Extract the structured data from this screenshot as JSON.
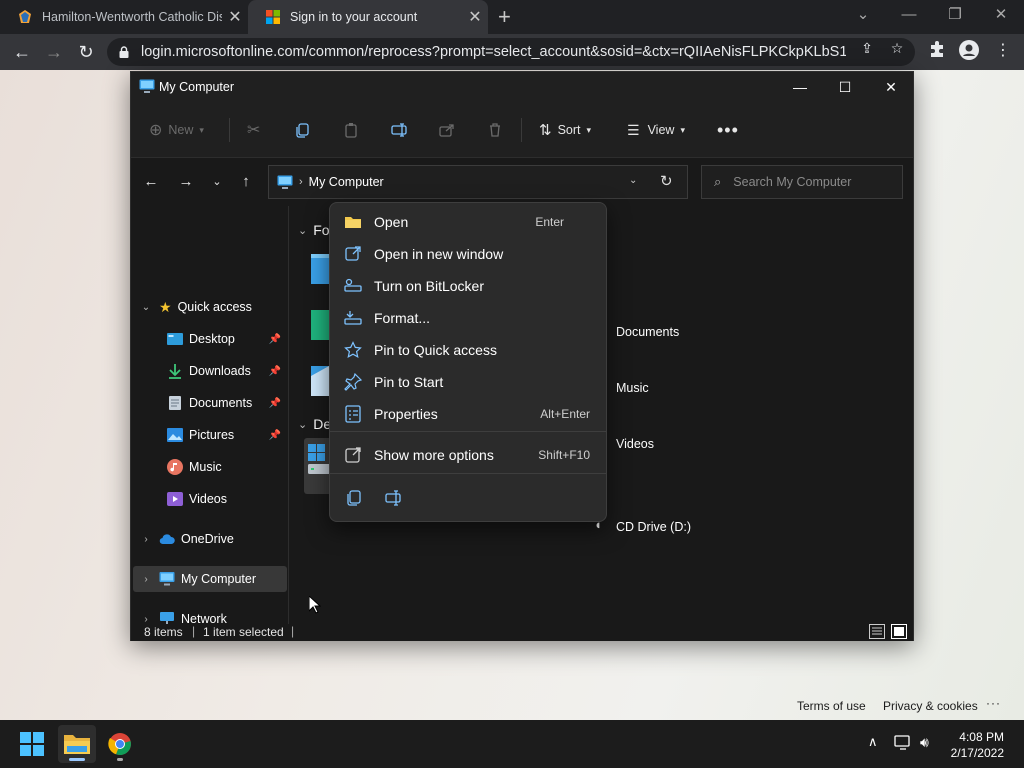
{
  "browser": {
    "tabs": [
      {
        "title": "Hamilton-Wentworth Catholic Dis",
        "active": false
      },
      {
        "title": "Sign in to your account",
        "active": true
      }
    ],
    "url": "login.microsoftonline.com/common/reprocess?prompt=select_account&sosid=&ctx=rQIIAeNisFLPKCkpKLbS188..."
  },
  "page": {
    "footer_links": [
      "Terms of use",
      "Privacy & cookies",
      "···"
    ]
  },
  "explorer": {
    "title": "My Computer",
    "commands": {
      "new": "New",
      "sort": "Sort",
      "view": "View"
    },
    "address": "My Computer",
    "search_placeholder": "Search My Computer",
    "nav": {
      "quick_access": "Quick access",
      "quick_items": [
        "Desktop",
        "Downloads",
        "Documents",
        "Pictures",
        "Music",
        "Videos"
      ],
      "onedrive": "OneDrive",
      "my_computer": "My Computer",
      "network": "Network"
    },
    "content": {
      "folders_header": "Fol",
      "devices_header": "De",
      "folder_labels": [
        "Documents",
        "Music",
        "Videos"
      ],
      "device_labels": [
        "CD Drive (D:)"
      ]
    },
    "status": {
      "items": "8 items",
      "selected": "1 item selected"
    }
  },
  "context_menu": {
    "items": [
      {
        "label": "Open",
        "shortcut": "Enter",
        "icon": "folder-icon"
      },
      {
        "label": "Open in new window",
        "shortcut": "",
        "icon": "open-external-icon"
      },
      {
        "label": "Turn on BitLocker",
        "shortcut": "",
        "icon": "bitlocker-key-icon"
      },
      {
        "label": "Format...",
        "shortcut": "",
        "icon": "format-drive-icon"
      },
      {
        "label": "Pin to Quick access",
        "shortcut": "",
        "icon": "star-icon"
      },
      {
        "label": "Pin to Start",
        "shortcut": "",
        "icon": "pin-icon"
      },
      {
        "label": "Properties",
        "shortcut": "Alt+Enter",
        "icon": "properties-icon"
      }
    ],
    "more": {
      "label": "Show more options",
      "shortcut": "Shift+F10"
    }
  },
  "taskbar": {
    "time": "4:08 PM",
    "date": "2/17/2022"
  },
  "colors": {
    "explorer_bg": "#191919",
    "menu_bg": "#2b2b2b",
    "accent": "#0078d4"
  }
}
